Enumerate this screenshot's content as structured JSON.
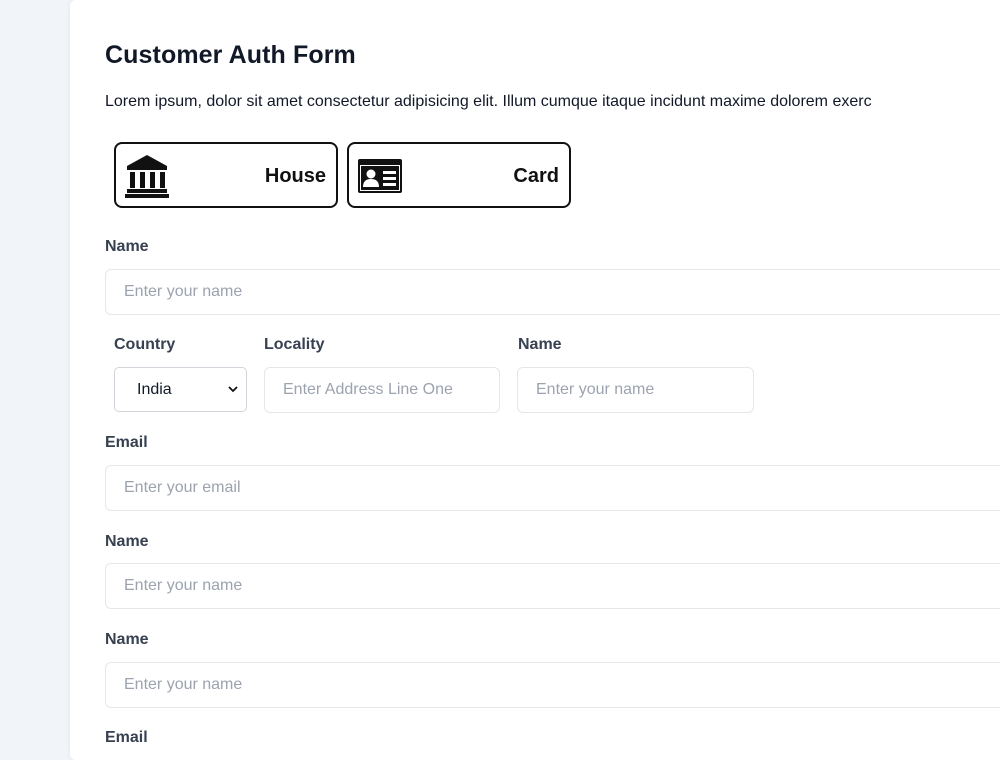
{
  "form": {
    "title": "Customer Auth Form",
    "description": "Lorem ipsum, dolor sit amet consectetur adipisicing elit. Illum cumque itaque incidunt maxime dolorem exerc",
    "choices": [
      {
        "label": "House",
        "icon": "bank-icon"
      },
      {
        "label": "Card",
        "icon": "id-card-icon"
      }
    ],
    "fields": {
      "name1": {
        "label": "Name",
        "placeholder": "Enter your name",
        "value": ""
      },
      "country": {
        "label": "Country",
        "selected": "India"
      },
      "locality": {
        "label": "Locality",
        "placeholder": "Enter Address Line One",
        "value": ""
      },
      "name2": {
        "label": "Name",
        "placeholder": "Enter your name",
        "value": ""
      },
      "email1": {
        "label": "Email",
        "placeholder": "Enter your email",
        "value": ""
      },
      "name3": {
        "label": "Name",
        "placeholder": "Enter your name",
        "value": ""
      },
      "name4": {
        "label": "Name",
        "placeholder": "Enter your name",
        "value": ""
      },
      "email2": {
        "label": "Email"
      }
    }
  }
}
